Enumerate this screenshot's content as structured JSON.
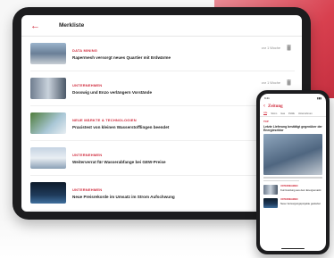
{
  "tablet": {
    "back_icon": "back-arrow-icon",
    "title": "Merkliste",
    "articles": [
      {
        "category": "DATA MINING",
        "headline": "Rapermesh versorgt neues Quartier mit Erdwärme",
        "meta": "vor 1 Woche"
      },
      {
        "category": "UNTERNEHMEN",
        "headline": "Dosswig und Enzo verlängern Vorstände",
        "meta": "vor 1 Woche"
      },
      {
        "category": "NEUE MÄRKTE & TECHNOLOGIEN",
        "headline": "Praxistest von kleinen Wasserstofflingen beendet",
        "meta": "vor 1 Woche"
      },
      {
        "category": "UNTERNEHMEN",
        "headline": "Weiterverrat für Wasserabfange bei GEW-Preise",
        "meta": "vor 1 Woche"
      },
      {
        "category": "UNTERNEHMEN",
        "headline": "Neue Preisrekorde im Umsatz im Strom Aufschwung",
        "meta": ""
      }
    ]
  },
  "phone": {
    "status_time": "9:41",
    "status_icons": "▮▮▮",
    "back_icon": "back-arrow-icon",
    "brand": "Zeitung",
    "tabs": [
      "Alle",
      "Strom",
      "Gas",
      "Politik",
      "Unternehmen"
    ],
    "section": "TOP",
    "lead_headline": "Letzte Lieferung bestätigt gegenüber der Energiesektor",
    "items": [
      {
        "category": "UNTERNEHMEN",
        "headline": "Kurzmeldung aus dem Energiemarkt"
      },
      {
        "category": "UNTERNEHMEN",
        "headline": "Neue Versorgungsprojekte gestartet"
      }
    ]
  },
  "colors": {
    "accent": "#d12e3f",
    "device": "#1c1c1e"
  }
}
